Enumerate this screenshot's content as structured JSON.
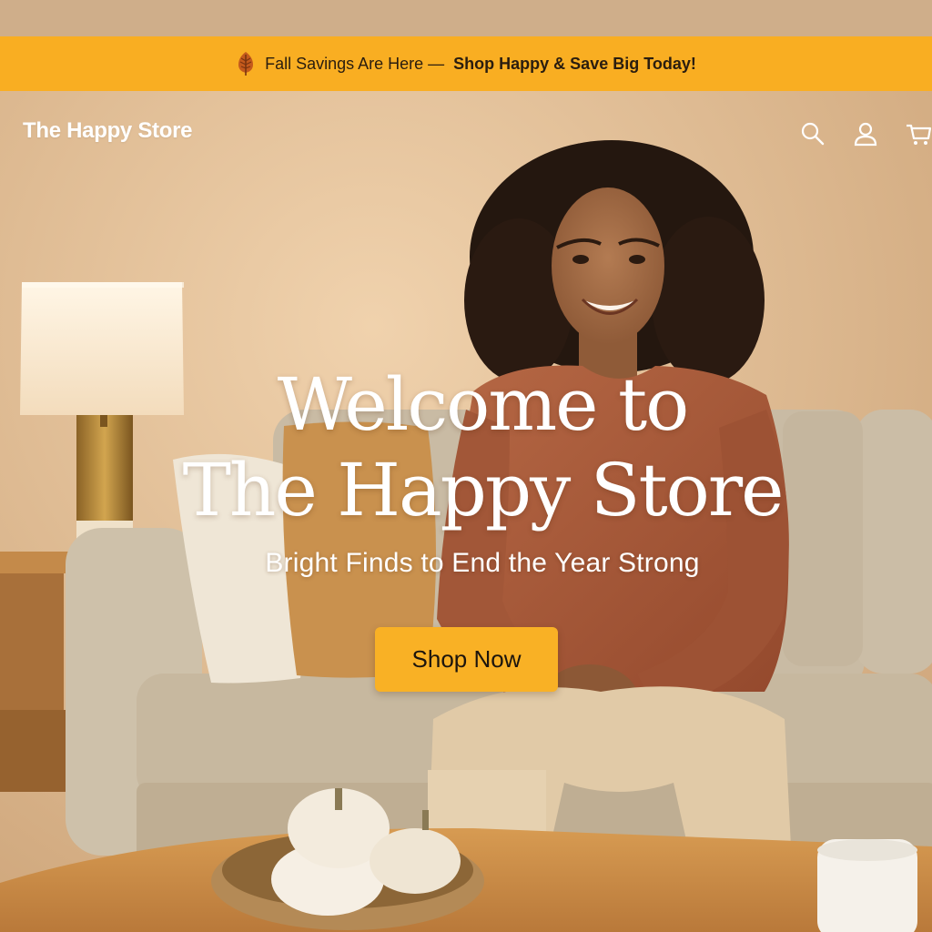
{
  "promo": {
    "icon": "leaf-icon",
    "lead": "Fall Savings Are Here —",
    "cta": "Shop Happy & Save Big Today!"
  },
  "header": {
    "logo": "The Happy Store",
    "icons": [
      "search-icon",
      "user-icon",
      "cart-icon"
    ]
  },
  "hero": {
    "title_line1": "Welcome to",
    "title_line2": "The Happy Store",
    "subtitle": "Bright Finds to End the Year Strong",
    "button_label": "Shop Now"
  },
  "colors": {
    "promo_bar": "#f9ae22",
    "button": "#f9b125",
    "sweater": "#a65a3a",
    "wall": "#d9b68e",
    "sofa": "#cdbfa8"
  }
}
